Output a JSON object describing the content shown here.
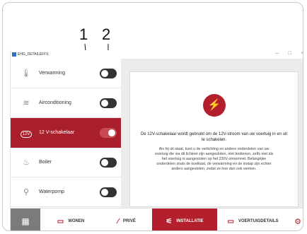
{
  "callouts": [
    "1",
    "2"
  ],
  "window": {
    "title": "EHG_DETAILEFFS",
    "controls": [
      "–",
      "□",
      "×"
    ]
  },
  "sidebar": {
    "items": [
      {
        "icon": "thermometer-icon",
        "glyph": "🌡",
        "label": "Verwarming",
        "state": "off"
      },
      {
        "icon": "air-icon",
        "glyph": "≋",
        "label": "Airconditioning",
        "state": "off"
      },
      {
        "icon": "battery-12v-icon",
        "glyph": "12V",
        "label": "12 V-schakelaar",
        "state": "on"
      },
      {
        "icon": "flame-icon",
        "glyph": "♨",
        "label": "Boiler",
        "state": "off"
      },
      {
        "icon": "pump-icon",
        "glyph": "⚲",
        "label": "Waterpomp",
        "state": "off"
      }
    ]
  },
  "info": {
    "icon": "plug-icon",
    "title": "De 12V-schakelaar wordt gebruikt om de 12V-stroom van uw voertuig in en uit te schakelen.",
    "body": "Als hij uit staat, kunt u de verlichting en andere onderdelen van uw voertuig die via dit lichtnet zijn aangesloten, niet bedienen, zelfs niet als het voertuig is aangesloten op het 230V-stroomnet. Belangrijke onderdelen zoals de koelkast, de verwarming en de instap zijn echter anders aangesloten, zodat ze hoe dan ook werken."
  },
  "nav": {
    "items": [
      {
        "label": "WONEN",
        "icon": "sofa-icon",
        "glyph": "▭"
      },
      {
        "label": "PRIVÉ",
        "icon": "privacy-icon",
        "glyph": "⁄"
      },
      {
        "label": "INSTALLATIE",
        "icon": "installation-icon",
        "glyph": "⚟",
        "active": true
      },
      {
        "label": "VOERTUIGDETAILS",
        "icon": "vehicle-icon",
        "glyph": "▭"
      }
    ]
  },
  "colors": {
    "accent": "#b31f2d",
    "active_row": "#a9202c"
  }
}
